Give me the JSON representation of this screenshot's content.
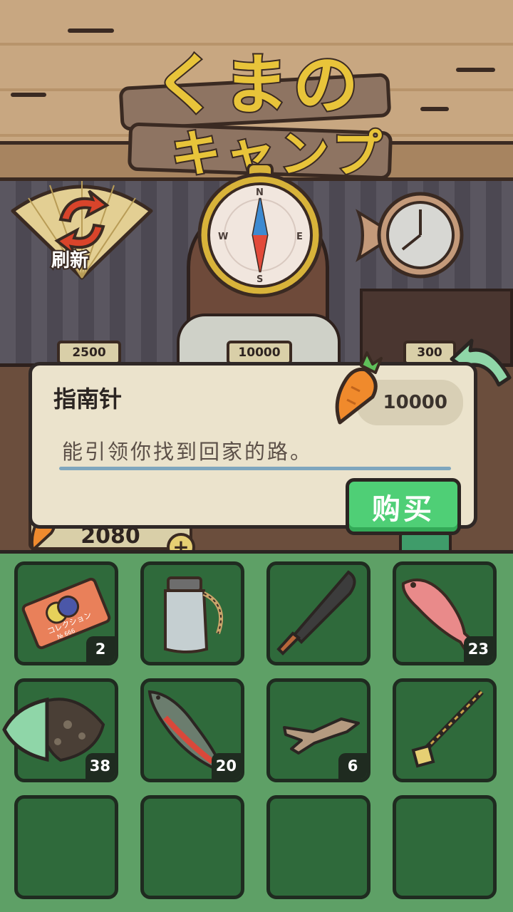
{
  "title_sign": {
    "line1": "くまの",
    "line2": "キャンプ"
  },
  "refresh": {
    "label": "刷新"
  },
  "shelf_prices": [
    "2500",
    "10000",
    "300"
  ],
  "item_info": {
    "name": "指南针",
    "price": "10000",
    "description": "能引领你找到回家的路。",
    "buy_label": "购买"
  },
  "wallet": {
    "carrots": "2080",
    "add_label": "+"
  },
  "inventory": {
    "slots": [
      {
        "icon": "ticket-icon",
        "count": "2",
        "ticket_text": "コレクション",
        "ticket_no": "№ 666"
      },
      {
        "icon": "jar-icon",
        "count": ""
      },
      {
        "icon": "machete-icon",
        "count": ""
      },
      {
        "icon": "red-snapper-icon",
        "count": "23"
      },
      {
        "icon": "scorpionfish-icon",
        "count": "38"
      },
      {
        "icon": "trout-icon",
        "count": "20"
      },
      {
        "icon": "driftwood-icon",
        "count": "6"
      },
      {
        "icon": "hoe-icon",
        "count": ""
      },
      {
        "icon": "",
        "count": ""
      },
      {
        "icon": "",
        "count": ""
      },
      {
        "icon": "",
        "count": ""
      },
      {
        "icon": "",
        "count": ""
      }
    ]
  },
  "colors": {
    "buy_green": "#4fcf76",
    "inventory_bg": "#5ea066",
    "slot_bg": "#2f6a3b",
    "panel_bg": "#ebe3cc",
    "title_yellow": "#e8c43a"
  }
}
